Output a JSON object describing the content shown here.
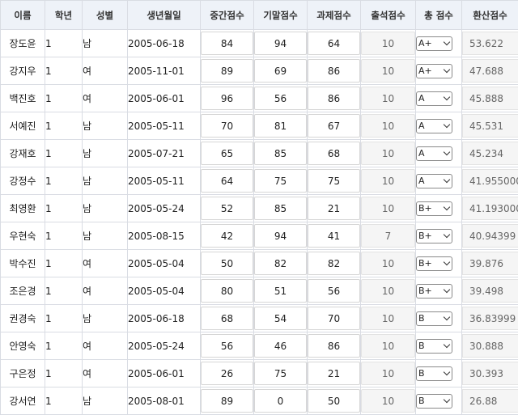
{
  "columns": [
    "이름",
    "학년",
    "성별",
    "생년월일",
    "중간점수",
    "기말점수",
    "과제점수",
    "출석점수",
    "총 점수",
    "환산점수"
  ],
  "students": [
    {
      "name": "장도윤",
      "grade": "1",
      "gender": "남",
      "birth": "2005-06-18",
      "mid": "84",
      "final": "94",
      "assign": "64",
      "attend": "10",
      "total": "A+",
      "converted": "53.622"
    },
    {
      "name": "강지우",
      "grade": "1",
      "gender": "여",
      "birth": "2005-11-01",
      "mid": "89",
      "final": "69",
      "assign": "86",
      "attend": "10",
      "total": "A+",
      "converted": "47.688"
    },
    {
      "name": "백진호",
      "grade": "1",
      "gender": "여",
      "birth": "2005-06-01",
      "mid": "96",
      "final": "56",
      "assign": "86",
      "attend": "10",
      "total": "A",
      "converted": "45.888"
    },
    {
      "name": "서예진",
      "grade": "1",
      "gender": "남",
      "birth": "2005-05-11",
      "mid": "70",
      "final": "81",
      "assign": "67",
      "attend": "10",
      "total": "A",
      "converted": "45.531"
    },
    {
      "name": "강재호",
      "grade": "1",
      "gender": "남",
      "birth": "2005-07-21",
      "mid": "65",
      "final": "85",
      "assign": "68",
      "attend": "10",
      "total": "A",
      "converted": "45.234"
    },
    {
      "name": "강정수",
      "grade": "1",
      "gender": "남",
      "birth": "2005-05-11",
      "mid": "64",
      "final": "75",
      "assign": "75",
      "attend": "10",
      "total": "A",
      "converted": "41.955000"
    },
    {
      "name": "최영환",
      "grade": "1",
      "gender": "남",
      "birth": "2005-05-24",
      "mid": "52",
      "final": "85",
      "assign": "21",
      "attend": "10",
      "total": "B+",
      "converted": "41.193000"
    },
    {
      "name": "우현숙",
      "grade": "1",
      "gender": "남",
      "birth": "2005-08-15",
      "mid": "42",
      "final": "94",
      "assign": "41",
      "attend": "7",
      "total": "B+",
      "converted": "40.94399"
    },
    {
      "name": "박수진",
      "grade": "1",
      "gender": "여",
      "birth": "2005-05-04",
      "mid": "50",
      "final": "82",
      "assign": "82",
      "attend": "10",
      "total": "B+",
      "converted": "39.876"
    },
    {
      "name": "조은경",
      "grade": "1",
      "gender": "여",
      "birth": "2005-05-04",
      "mid": "80",
      "final": "51",
      "assign": "56",
      "attend": "10",
      "total": "B+",
      "converted": "39.498"
    },
    {
      "name": "권경숙",
      "grade": "1",
      "gender": "남",
      "birth": "2005-06-18",
      "mid": "68",
      "final": "54",
      "assign": "70",
      "attend": "10",
      "total": "B",
      "converted": "36.83999"
    },
    {
      "name": "안영숙",
      "grade": "1",
      "gender": "여",
      "birth": "2005-05-24",
      "mid": "56",
      "final": "46",
      "assign": "86",
      "attend": "10",
      "total": "B",
      "converted": "30.888"
    },
    {
      "name": "구은정",
      "grade": "1",
      "gender": "여",
      "birth": "2005-06-01",
      "mid": "26",
      "final": "75",
      "assign": "21",
      "attend": "10",
      "total": "B",
      "converted": "30.393"
    },
    {
      "name": "강서연",
      "grade": "1",
      "gender": "남",
      "birth": "2005-08-01",
      "mid": "89",
      "final": "0",
      "assign": "50",
      "attend": "10",
      "total": "B",
      "converted": "26.88"
    }
  ]
}
